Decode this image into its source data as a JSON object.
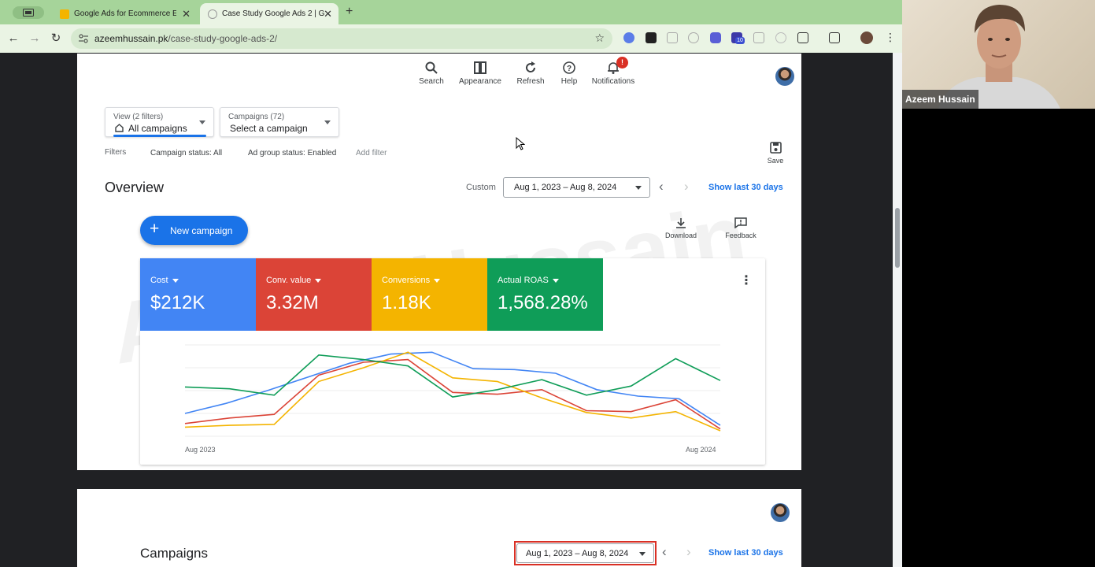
{
  "browser": {
    "tabs": [
      {
        "title": "Google Ads for Ecommerce E",
        "active": false
      },
      {
        "title": "Case Study Google Ads 2 | G",
        "active": true
      }
    ],
    "url_host": "azeemhussain.pk",
    "url_path": "/case-study-google-ads-2/",
    "extension_badge": "10"
  },
  "top_actions": [
    {
      "label": "Search",
      "icon": "search-icon"
    },
    {
      "label": "Appearance",
      "icon": "appearance-icon"
    },
    {
      "label": "Refresh",
      "icon": "refresh-icon"
    },
    {
      "label": "Help",
      "icon": "help-icon"
    },
    {
      "label": "Notifications",
      "icon": "bell-icon",
      "badge": "!"
    }
  ],
  "view_dropdown": {
    "caption": "View (2 filters)",
    "value": "All campaigns"
  },
  "campaign_dropdown": {
    "caption": "Campaigns (72)",
    "value": "Select a campaign"
  },
  "filters": {
    "label": "Filters",
    "chips": [
      "Campaign status: All",
      "Ad group status: Enabled"
    ],
    "add": "Add filter"
  },
  "save_label": "Save",
  "overview": {
    "title": "Overview",
    "custom_label": "Custom",
    "date_range": "Aug 1, 2023 – Aug 8, 2024",
    "show_last": "Show last 30 days",
    "new_campaign": "New campaign",
    "download": "Download",
    "feedback": "Feedback"
  },
  "metrics": [
    {
      "label": "Cost",
      "value": "$212K",
      "color": "#4285f4"
    },
    {
      "label": "Conv. value",
      "value": "3.32M",
      "color": "#db4437"
    },
    {
      "label": "Conversions",
      "value": "1.18K",
      "color": "#f4b400"
    },
    {
      "label": "Actual ROAS",
      "value": "1,568.28%",
      "color": "#0f9d58"
    }
  ],
  "chart_data": {
    "type": "line",
    "x_start_label": "Aug 2023",
    "x_end_label": "Aug 2024",
    "y_range": [
      0,
      100
    ],
    "grid": true,
    "series": [
      {
        "color": "#4285f4",
        "values": [
          25,
          36,
          50,
          65,
          80,
          90,
          92,
          74,
          73,
          69,
          51,
          44,
          41,
          12
        ]
      },
      {
        "color": "#db4437",
        "values": [
          14,
          20,
          24,
          67,
          81,
          84,
          48,
          46,
          51,
          28,
          27,
          40,
          8
        ]
      },
      {
        "color": "#f4b400",
        "values": [
          10,
          12,
          13,
          60,
          75,
          92,
          64,
          60,
          42,
          26,
          20,
          27,
          6
        ]
      },
      {
        "color": "#0f9d58",
        "values": [
          54,
          52,
          45,
          89,
          84,
          77,
          43,
          51,
          62,
          45,
          55,
          85,
          61
        ]
      }
    ]
  },
  "campaigns": {
    "title": "Campaigns",
    "date_range": "Aug 1, 2023 – Aug 8, 2024",
    "show_last": "Show last 30 days"
  },
  "webcam": {
    "name": "Azeem Hussain"
  }
}
